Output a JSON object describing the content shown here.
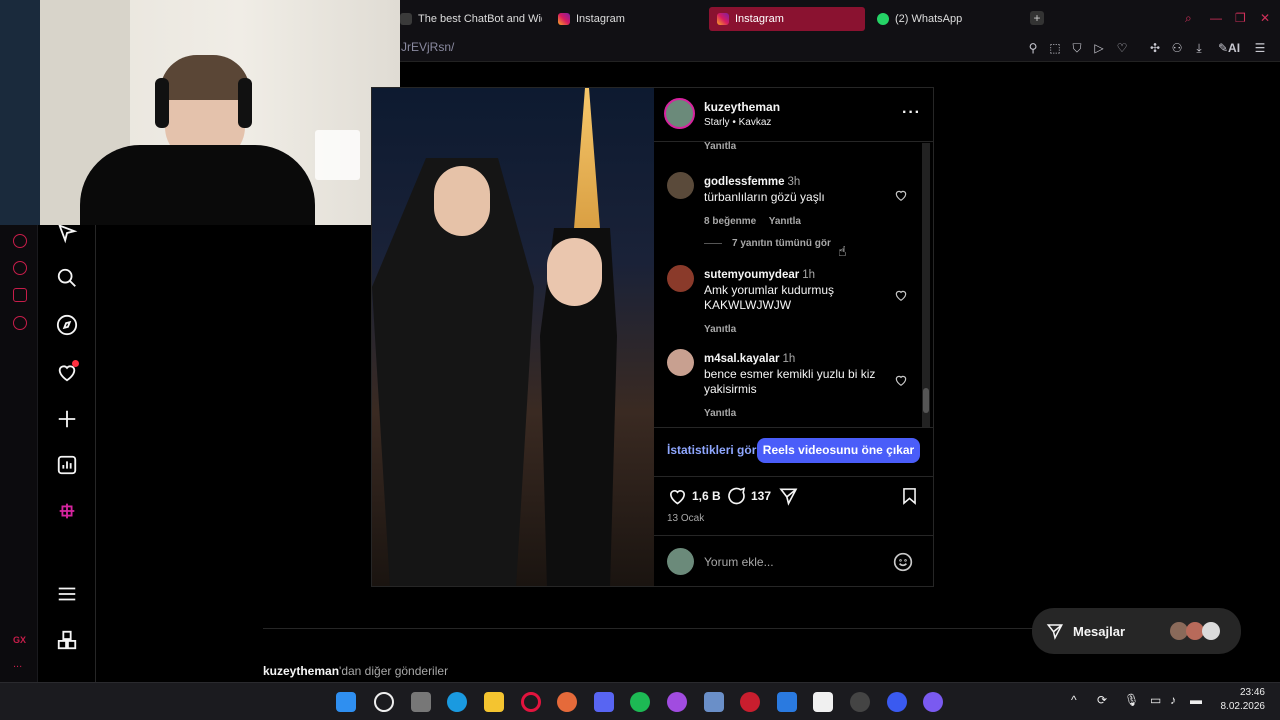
{
  "browser": {
    "tabs": [
      {
        "label": "The best ChatBot and Wid"
      },
      {
        "label": "Instagram"
      },
      {
        "label": "Instagram"
      },
      {
        "label": "(2) WhatsApp"
      }
    ],
    "url_fragment": "JrEVjRsn/",
    "ai_label": "AI"
  },
  "post": {
    "author": "kuzeytheman",
    "audio_artist": "Starly",
    "audio_sep": "•",
    "audio_title": "Kavkaz",
    "top_reply_label": "Yanıtla",
    "comments": [
      {
        "user": "godlessfemme",
        "time": "3h",
        "text": "türbanlıların gözü yaşlı",
        "likes": "8 beğenme",
        "reply": "Yanıtla"
      },
      {
        "user": "sutemyoumydear",
        "time": "1h",
        "text": "Amk yorumlar kudurmuş KAKWLWJWJW",
        "reply": "Yanıtla"
      },
      {
        "user": "m4sal.kayalar",
        "time": "1h",
        "text": "bence esmer kemikli yuzlu bi kiz yakisirmis",
        "reply": "Yanıtla"
      }
    ],
    "view_replies": "7 yanıtın tümünü gör",
    "stats_button": "İstatistikleri gör",
    "boost_button": "Reels videosunu öne çıkar",
    "like_count": "1,6 B",
    "comment_count": "137",
    "date": "13 Ocak",
    "comment_placeholder": "Yorum ekle..."
  },
  "footer": {
    "more_posts_user": "kuzeytheman",
    "more_posts_suffix": "'dan diğer gönderiler"
  },
  "messages": {
    "label": "Mesajlar"
  },
  "sidebar": {
    "gx_label": "GX",
    "more": "..."
  },
  "taskbar": {
    "time": "23:46",
    "date": "8.02.2026"
  },
  "colors": {
    "accent": "#c71d4a",
    "instagram_blue": "#4a5df9",
    "link_blue": "#8fa7ff"
  }
}
